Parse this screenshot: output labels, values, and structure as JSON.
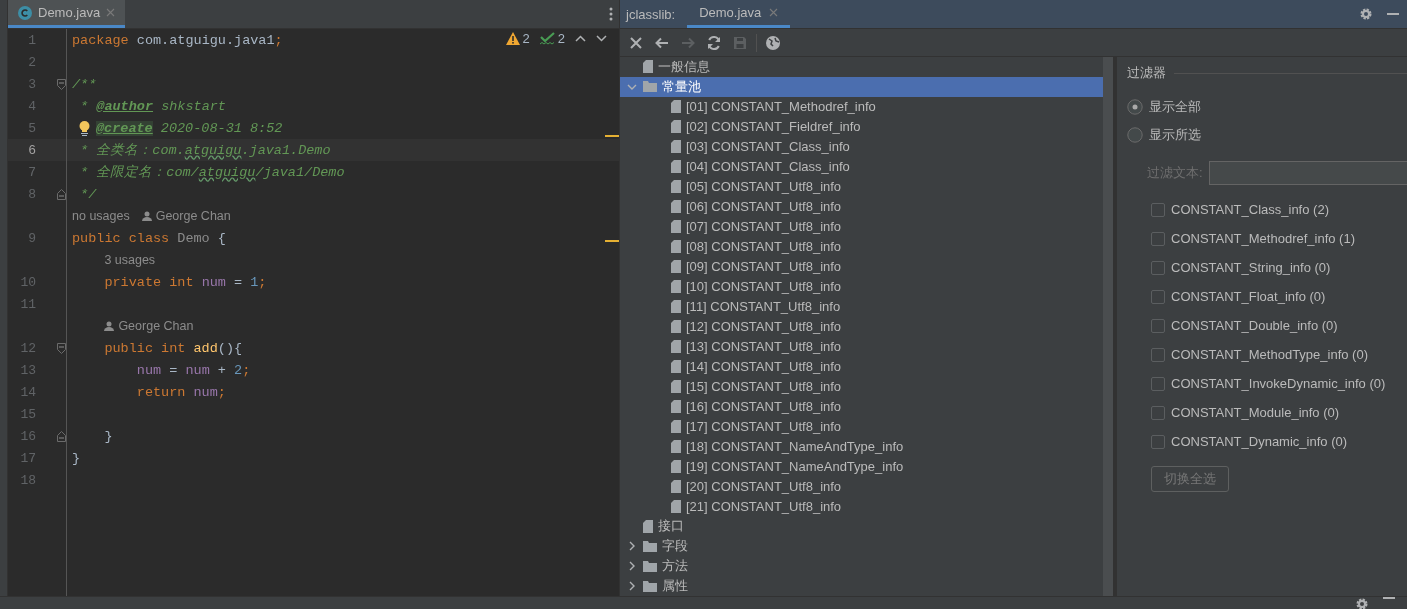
{
  "editor": {
    "tab": {
      "label": "Demo.java",
      "selected": true
    },
    "inspections": [
      {
        "kind": "warning",
        "count": "2"
      },
      {
        "kind": "typo",
        "count": "2"
      }
    ],
    "lines": [
      {
        "kind": "code",
        "number": "1",
        "current": false,
        "tokens": [
          {
            "text": "package",
            "kind": "keyword"
          },
          {
            "text": " com.atguigu.java1",
            "kind": "plain"
          },
          {
            "text": ";",
            "kind": "keyword"
          }
        ]
      },
      {
        "kind": "code",
        "number": "2",
        "current": false
      },
      {
        "kind": "code",
        "number": "3",
        "current": false,
        "fold_start": true,
        "fold_end": false,
        "tokens": [
          {
            "text": "/**",
            "kind": "comment"
          }
        ]
      },
      {
        "kind": "code",
        "number": "4",
        "current": false,
        "tokens": [
          {
            "text": " * ",
            "kind": "comment"
          },
          {
            "text": "@author",
            "kind": "doctag"
          },
          {
            "text": " shkstart",
            "kind": "comment"
          }
        ]
      },
      {
        "kind": "code",
        "number": "5",
        "current": false,
        "bulb": true,
        "tokens": [
          {
            "text": "@create",
            "kind": "doctag_highlight"
          },
          {
            "text": " 2020-08-31 8:52",
            "kind": "comment"
          }
        ]
      },
      {
        "kind": "code",
        "number": "6",
        "current": true,
        "tokens": [
          {
            "text": " * 全类名：com.",
            "kind": "comment"
          },
          {
            "text": "atguigu",
            "kind": "typo"
          },
          {
            "text": ".java1.Demo",
            "kind": "comment"
          }
        ]
      },
      {
        "kind": "code",
        "number": "7",
        "current": false,
        "tokens": [
          {
            "text": " * 全限定名：com/",
            "kind": "comment"
          },
          {
            "text": "atguigu",
            "kind": "typo"
          },
          {
            "text": "/java1/Demo",
            "kind": "comment"
          }
        ]
      },
      {
        "kind": "code",
        "number": "8",
        "current": false,
        "fold_start": false,
        "fold_end": true,
        "tokens": [
          {
            "text": " */",
            "kind": "comment"
          }
        ]
      },
      {
        "kind": "hint",
        "items": [
          {
            "text": "no usages",
            "kind": "usages"
          },
          {
            "text": "George Chan",
            "kind": "author"
          }
        ]
      },
      {
        "kind": "code",
        "number": "9",
        "current": false,
        "tokens": [
          {
            "text": "public class",
            "kind": "keyword"
          },
          {
            "text": " Demo",
            "kind": "unused"
          },
          {
            "text": " {",
            "kind": "plain"
          }
        ]
      },
      {
        "kind": "hint",
        "items": [
          {
            "text": "3 usages",
            "kind": "usages"
          }
        ]
      },
      {
        "kind": "code",
        "number": "10",
        "current": false,
        "tokens": [
          {
            "text": "    private int",
            "kind": "keyword"
          },
          {
            "text": " num",
            "kind": "field"
          },
          {
            "text": " = ",
            "kind": "plain"
          },
          {
            "text": "1",
            "kind": "number"
          },
          {
            "text": ";",
            "kind": "keyword"
          }
        ]
      },
      {
        "kind": "code",
        "number": "11",
        "current": false
      },
      {
        "kind": "hint",
        "items": [
          {
            "text": "George Chan",
            "kind": "author"
          }
        ]
      },
      {
        "kind": "code",
        "number": "12",
        "current": false,
        "fold_start": true,
        "fold_end": false,
        "tokens": [
          {
            "text": "    public int",
            "kind": "keyword"
          },
          {
            "text": " add",
            "kind": "method"
          },
          {
            "text": "(){",
            "kind": "plain"
          }
        ]
      },
      {
        "kind": "code",
        "number": "13",
        "current": false,
        "tokens": [
          {
            "text": "        num",
            "kind": "field"
          },
          {
            "text": " = ",
            "kind": "plain"
          },
          {
            "text": "num",
            "kind": "field"
          },
          {
            "text": " + ",
            "kind": "plain"
          },
          {
            "text": "2",
            "kind": "number"
          },
          {
            "text": ";",
            "kind": "keyword"
          }
        ]
      },
      {
        "kind": "code",
        "number": "14",
        "current": false,
        "tokens": [
          {
            "text": "        return",
            "kind": "keyword"
          },
          {
            "text": " num",
            "kind": "field"
          },
          {
            "text": ";",
            "kind": "keyword"
          }
        ]
      },
      {
        "kind": "code",
        "number": "15",
        "current": false
      },
      {
        "kind": "code",
        "number": "16",
        "current": false,
        "fold_start": false,
        "fold_end": true,
        "tokens": [
          {
            "text": "    }",
            "kind": "plain"
          }
        ]
      },
      {
        "kind": "code",
        "number": "17",
        "current": false,
        "tokens": [
          {
            "text": "}",
            "kind": "plain"
          }
        ]
      },
      {
        "kind": "code",
        "number": "18",
        "current": false
      }
    ]
  },
  "tool_window": {
    "title": "jclasslib:",
    "tabs": [
      {
        "label": "Demo.java",
        "selected": true
      }
    ],
    "toolbar": [
      {
        "kind": "close",
        "disabled": false
      },
      {
        "kind": "back",
        "disabled": false
      },
      {
        "kind": "forward",
        "disabled": true
      },
      {
        "kind": "refresh",
        "disabled": false
      },
      {
        "kind": "save",
        "disabled": true
      },
      {
        "kind": "web",
        "disabled": false
      }
    ],
    "tree": [
      {
        "label": "一般信息",
        "kind": "file",
        "selected": false
      },
      {
        "label": "常量池",
        "kind": "folder",
        "expanded": true,
        "selected": true,
        "children": [
          {
            "label": "[01] CONSTANT_Methodref_info",
            "kind": "file",
            "selected": false
          },
          {
            "label": "[02] CONSTANT_Fieldref_info",
            "kind": "file",
            "selected": false
          },
          {
            "label": "[03] CONSTANT_Class_info",
            "kind": "file",
            "selected": false
          },
          {
            "label": "[04] CONSTANT_Class_info",
            "kind": "file",
            "selected": false
          },
          {
            "label": "[05] CONSTANT_Utf8_info",
            "kind": "file",
            "selected": false
          },
          {
            "label": "[06] CONSTANT_Utf8_info",
            "kind": "file",
            "selected": false
          },
          {
            "label": "[07] CONSTANT_Utf8_info",
            "kind": "file",
            "selected": false
          },
          {
            "label": "[08] CONSTANT_Utf8_info",
            "kind": "file",
            "selected": false
          },
          {
            "label": "[09] CONSTANT_Utf8_info",
            "kind": "file",
            "selected": false
          },
          {
            "label": "[10] CONSTANT_Utf8_info",
            "kind": "file",
            "selected": false
          },
          {
            "label": "[11] CONSTANT_Utf8_info",
            "kind": "file",
            "selected": false
          },
          {
            "label": "[12] CONSTANT_Utf8_info",
            "kind": "file",
            "selected": false
          },
          {
            "label": "[13] CONSTANT_Utf8_info",
            "kind": "file",
            "selected": false
          },
          {
            "label": "[14] CONSTANT_Utf8_info",
            "kind": "file",
            "selected": false
          },
          {
            "label": "[15] CONSTANT_Utf8_info",
            "kind": "file",
            "selected": false
          },
          {
            "label": "[16] CONSTANT_Utf8_info",
            "kind": "file",
            "selected": false
          },
          {
            "label": "[17] CONSTANT_Utf8_info",
            "kind": "file",
            "selected": false
          },
          {
            "label": "[18] CONSTANT_NameAndType_info",
            "kind": "file",
            "selected": false
          },
          {
            "label": "[19] CONSTANT_NameAndType_info",
            "kind": "file",
            "selected": false
          },
          {
            "label": "[20] CONSTANT_Utf8_info",
            "kind": "file",
            "selected": false
          },
          {
            "label": "[21] CONSTANT_Utf8_info",
            "kind": "file",
            "selected": false
          }
        ]
      },
      {
        "label": "接口",
        "kind": "file",
        "selected": false
      },
      {
        "label": "字段",
        "kind": "folder",
        "expanded": false,
        "selected": false
      },
      {
        "label": "方法",
        "kind": "folder",
        "expanded": false,
        "selected": false
      },
      {
        "label": "属性",
        "kind": "folder",
        "expanded": false,
        "selected": false
      }
    ],
    "filter": {
      "title": "过滤器",
      "modes": [
        {
          "label": "显示全部",
          "selected": true
        },
        {
          "label": "显示所选",
          "selected": false
        }
      ],
      "filter_text": {
        "label": "过滤文本:",
        "disabled": true
      },
      "types": [
        {
          "label": "CONSTANT_Class_info (2)",
          "checked": false
        },
        {
          "label": "CONSTANT_Methodref_info (1)",
          "checked": false
        },
        {
          "label": "CONSTANT_String_info (0)",
          "checked": false
        },
        {
          "label": "CONSTANT_Float_info (0)",
          "checked": false
        },
        {
          "label": "CONSTANT_Double_info (0)",
          "checked": false
        },
        {
          "label": "CONSTANT_MethodType_info (0)",
          "checked": false
        },
        {
          "label": "CONSTANT_InvokeDynamic_info (0)",
          "checked": false
        },
        {
          "label": "CONSTANT_Module_info (0)",
          "checked": false
        },
        {
          "label": "CONSTANT_Dynamic_info (0)",
          "checked": false
        }
      ],
      "toggle_button": {
        "label": "切换全选",
        "disabled": true
      }
    }
  }
}
